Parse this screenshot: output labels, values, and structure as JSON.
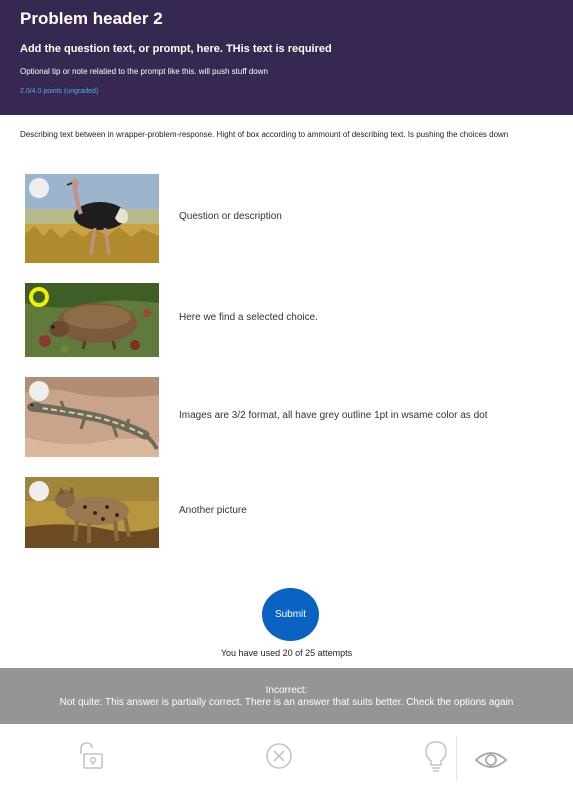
{
  "header": {
    "title": "Problem header 2",
    "prompt": "Add the question text, or prompt, here. THis text is required",
    "tip": "Optional tip or note relatied to the prompt like this. will push stuff down",
    "points": "2.0/4.0 points (ungraded)",
    "background_color": "#372851",
    "points_color": "#55a9f0"
  },
  "description": "Describing text between in wrapper-problem-response. Hight of box according to ammount of describing text. Is pushing the choices down",
  "choices": [
    {
      "label": "Question or description",
      "image": "ostrich",
      "selected": false
    },
    {
      "label": "Here we find a selected choice.",
      "image": "beaver",
      "selected": true
    },
    {
      "label": "Images are 3/2 format, all have grey outline 1pt in wsame color as dot",
      "image": "lizard",
      "selected": false
    },
    {
      "label": "Another picture",
      "image": "hyena",
      "selected": false
    }
  ],
  "selected_dot_color": "#f2f200",
  "submit": {
    "label": "Submit",
    "color": "#0a63c2"
  },
  "attempts": "You have used 20 of 25 attempts",
  "feedback": {
    "title": "Incorrect:",
    "message": "Not quite: This answer is partially correct. There is an answer that suits better. Check the options again",
    "background_color": "#959595"
  },
  "toolbar": {
    "icons": [
      "unlock-icon",
      "close-circle-icon",
      "lightbulb-icon",
      "eye-icon"
    ]
  }
}
